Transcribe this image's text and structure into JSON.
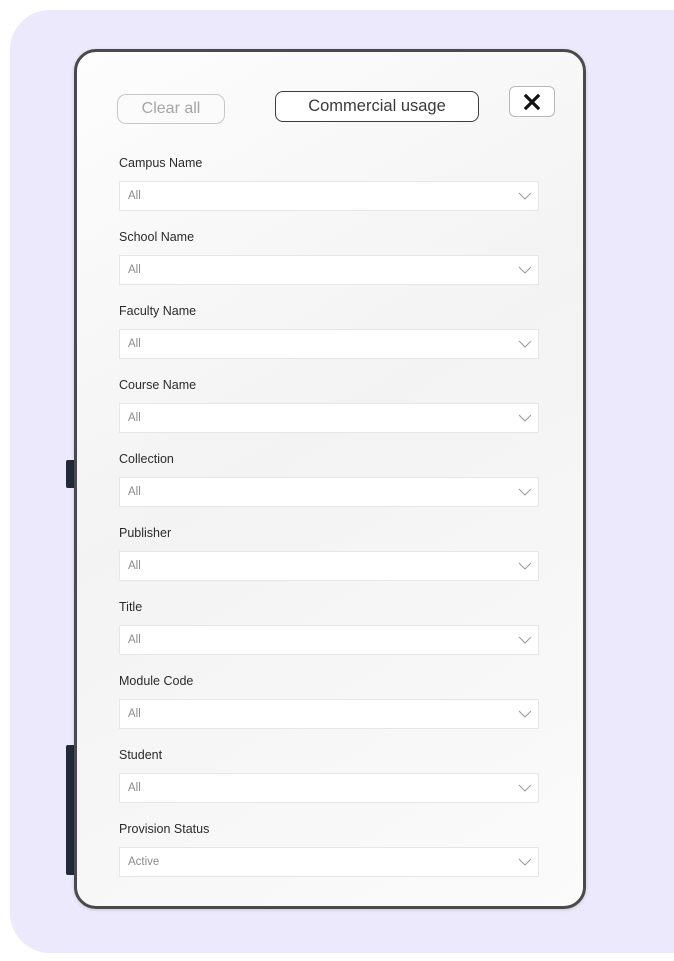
{
  "toolbar": {
    "clear_all_label": "Clear all",
    "commercial_usage_label": "Commercial usage",
    "close_icon": "close-icon"
  },
  "filters": [
    {
      "label": "Campus Name",
      "value": "All"
    },
    {
      "label": "School Name",
      "value": "All"
    },
    {
      "label": "Faculty Name",
      "value": "All"
    },
    {
      "label": "Course Name",
      "value": "All"
    },
    {
      "label": "Collection",
      "value": "All"
    },
    {
      "label": "Publisher",
      "value": "All"
    },
    {
      "label": "Title",
      "value": "All"
    },
    {
      "label": "Module Code",
      "value": "All"
    },
    {
      "label": "Student",
      "value": "All"
    },
    {
      "label": "Provision Status",
      "value": "Active"
    }
  ],
  "colors": {
    "backdrop": "#ebe9fb",
    "panel_border": "#4a4a4a",
    "label_text": "#2a2a2a",
    "value_text": "#8c8c8c"
  }
}
